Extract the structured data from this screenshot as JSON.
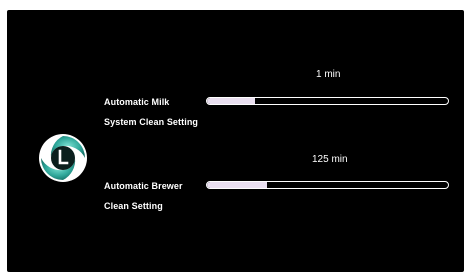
{
  "settings": [
    {
      "label_line1": "Automatic Milk",
      "label_line2": "System Clean Setting",
      "value": "1 min",
      "fill_fraction": 0.2
    },
    {
      "label_line1": "Automatic Brewer",
      "label_line2": "Clean Setting",
      "value": "125 min",
      "fill_fraction": 0.25
    }
  ],
  "icons": {
    "logo": "clock-cleaning-icon"
  },
  "colors": {
    "background": "#000000",
    "text": "#ffffff",
    "slider_fill": "#e9dff0",
    "logo_teal": "#2fa79a"
  }
}
